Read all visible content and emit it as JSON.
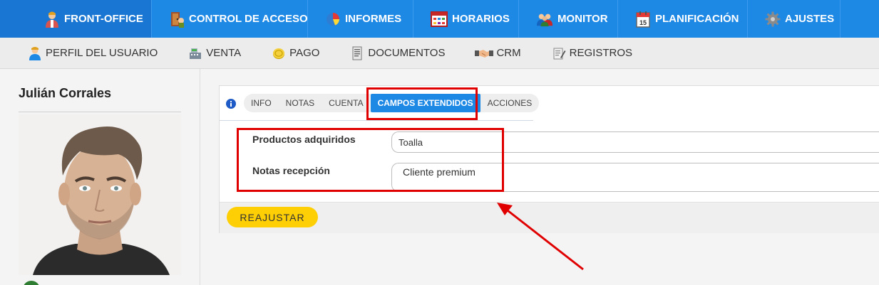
{
  "topnav": {
    "items": [
      {
        "label": "FRONT-OFFICE",
        "icon": "front-office-user-icon",
        "active": true
      },
      {
        "label": "CONTROL DE ACCESO",
        "icon": "access-control-icon"
      },
      {
        "label": "INFORMES",
        "icon": "pie-chart-icon"
      },
      {
        "label": "HORARIOS",
        "icon": "calendar-grid-icon"
      },
      {
        "label": "MONITOR",
        "icon": "users-group-icon"
      },
      {
        "label": "PLANIFICACIÓN",
        "icon": "calendar-day-icon"
      },
      {
        "label": "AJUSTES",
        "icon": "gear-icon"
      }
    ],
    "colors": {
      "bar": "#1e88e5",
      "active": "#1976d2"
    }
  },
  "subnav": {
    "items": [
      {
        "label": "PERFIL DEL USUARIO",
        "icon": "user-profile-icon"
      },
      {
        "label": "VENTA",
        "icon": "cash-register-icon"
      },
      {
        "label": "PAGO",
        "icon": "coin-icon"
      },
      {
        "label": "DOCUMENTOS",
        "icon": "document-icon"
      },
      {
        "label": "CRM",
        "icon": "handshake-icon"
      },
      {
        "label": "REGISTROS",
        "icon": "log-edit-icon"
      }
    ]
  },
  "profile": {
    "name": "Julián Corrales"
  },
  "tabs": {
    "items": [
      "INFO",
      "NOTAS",
      "CUENTA",
      "CAMPOS EXTENDIDOS",
      "ACCIONES"
    ],
    "active": "CAMPOS EXTENDIDOS"
  },
  "form": {
    "fields": [
      {
        "label": "Productos adquiridos",
        "value": "Toalla"
      },
      {
        "label": "Notas recepción",
        "value": "Cliente premium"
      }
    ],
    "reset_label": "REAJUSTAR"
  },
  "colors": {
    "accent": "#1e88e5",
    "button": "#ffcf05",
    "annotation": "#e00000"
  }
}
